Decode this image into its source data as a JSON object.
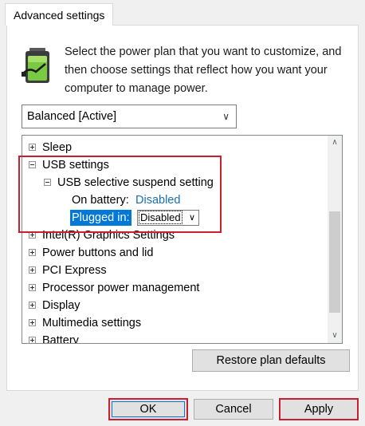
{
  "tab": {
    "label": "Advanced settings"
  },
  "description": "Select the power plan that you want to customize, and then choose settings that reflect how you want your computer to manage power.",
  "plan_select": {
    "value": "Balanced [Active]"
  },
  "tree": {
    "items": {
      "sleep": "Sleep",
      "usb_settings": "USB settings",
      "usb_suspend": "USB selective suspend setting",
      "on_battery_label": "On battery:",
      "on_battery_value": "Disabled",
      "plugged_in_label": "Plugged in:",
      "plugged_in_value": "Disabled",
      "graphics": "Intel(R) Graphics Settings",
      "power_buttons": "Power buttons and lid",
      "pci": "PCI Express",
      "processor": "Processor power management",
      "display": "Display",
      "multimedia": "Multimedia settings",
      "battery": "Battery"
    }
  },
  "buttons": {
    "restore": "Restore plan defaults",
    "ok": "OK",
    "cancel": "Cancel",
    "apply": "Apply"
  },
  "colors": {
    "highlight": "#c8202e",
    "selection": "#0078d7",
    "link": "#1a6fb0"
  }
}
